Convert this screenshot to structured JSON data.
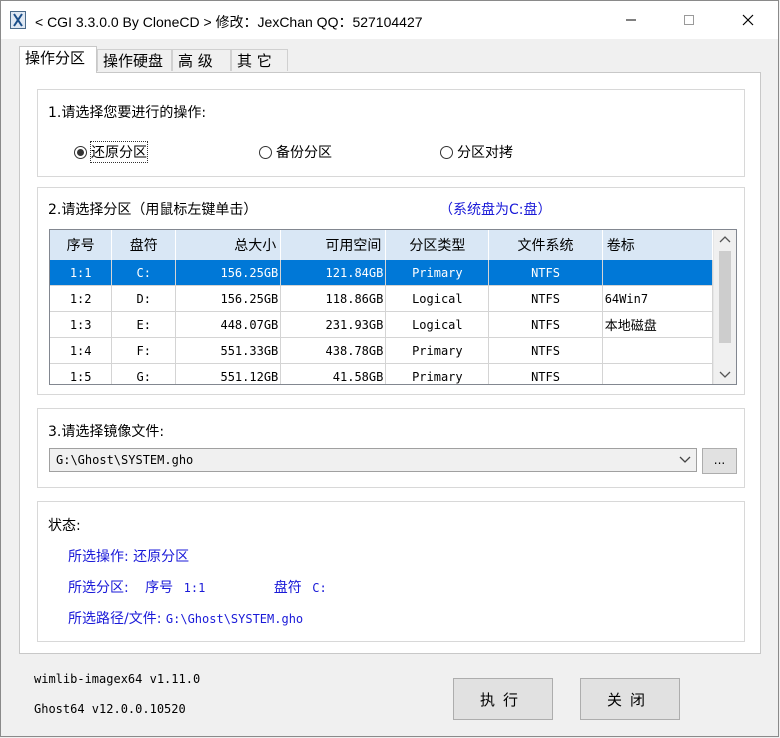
{
  "window": {
    "title": "< CGI 3.3.0.0 By CloneCD > 修改：JexChan  QQ：527104427",
    "icon": "cgi-app-icon",
    "controls": [
      "minimize-icon",
      "maximize-icon",
      "close-icon"
    ]
  },
  "tabs": [
    {
      "label": "操作分区",
      "active": true
    },
    {
      "label": "操作硬盘",
      "active": false
    },
    {
      "label": "高 级",
      "active": false
    },
    {
      "label": "其 它",
      "active": false
    }
  ],
  "operation": {
    "label": "1.请选择您要进行的操作:",
    "options": [
      {
        "label": "还原分区",
        "checked": true
      },
      {
        "label": "备份分区",
        "checked": false
      },
      {
        "label": "分区对拷",
        "checked": false
      }
    ]
  },
  "partition": {
    "label": "2.请选择分区（用鼠标左键单击）",
    "system_note": "（系统盘为C:盘）",
    "columns": [
      "序号",
      "盘符",
      "总大小",
      "可用空间",
      "分区类型",
      "文件系统",
      "卷标"
    ],
    "rows": [
      {
        "index": "1:1",
        "drive": "C:",
        "total": "156.25GB",
        "free": "121.84GB",
        "type": "Primary",
        "fs": "NTFS",
        "label": ""
      },
      {
        "index": "1:2",
        "drive": "D:",
        "total": "156.25GB",
        "free": "118.86GB",
        "type": "Logical",
        "fs": "NTFS",
        "label": "64Win7"
      },
      {
        "index": "1:3",
        "drive": "E:",
        "total": "448.07GB",
        "free": "231.93GB",
        "type": "Logical",
        "fs": "NTFS",
        "label": "本地磁盘"
      },
      {
        "index": "1:4",
        "drive": "F:",
        "total": "551.33GB",
        "free": "438.78GB",
        "type": "Primary",
        "fs": "NTFS",
        "label": ""
      },
      {
        "index": "1:5",
        "drive": "G:",
        "total": "551.12GB",
        "free": "41.58GB",
        "type": "Primary",
        "fs": "NTFS",
        "label": ""
      }
    ],
    "selected_row": 0
  },
  "image_file": {
    "label": "3.请选择镜像文件:",
    "value": "G:\\Ghost\\SYSTEM.gho",
    "browse_label": "..."
  },
  "status": {
    "label": "状态:",
    "operation_label": "所选操作:",
    "operation_value": "还原分区",
    "partition_label": "所选分区:",
    "index_label": "序号",
    "index_value": "1:1",
    "drive_label": "盘符",
    "drive_value": "C:",
    "path_label": "所选路径/文件:",
    "path_value": "G:\\Ghost\\SYSTEM.gho"
  },
  "footer": {
    "wimlib_version": "wimlib-imagex64 v1.11.0",
    "ghost_version": "Ghost64 v12.0.0.10520",
    "execute_label": "执行",
    "close_label": "关闭"
  }
}
